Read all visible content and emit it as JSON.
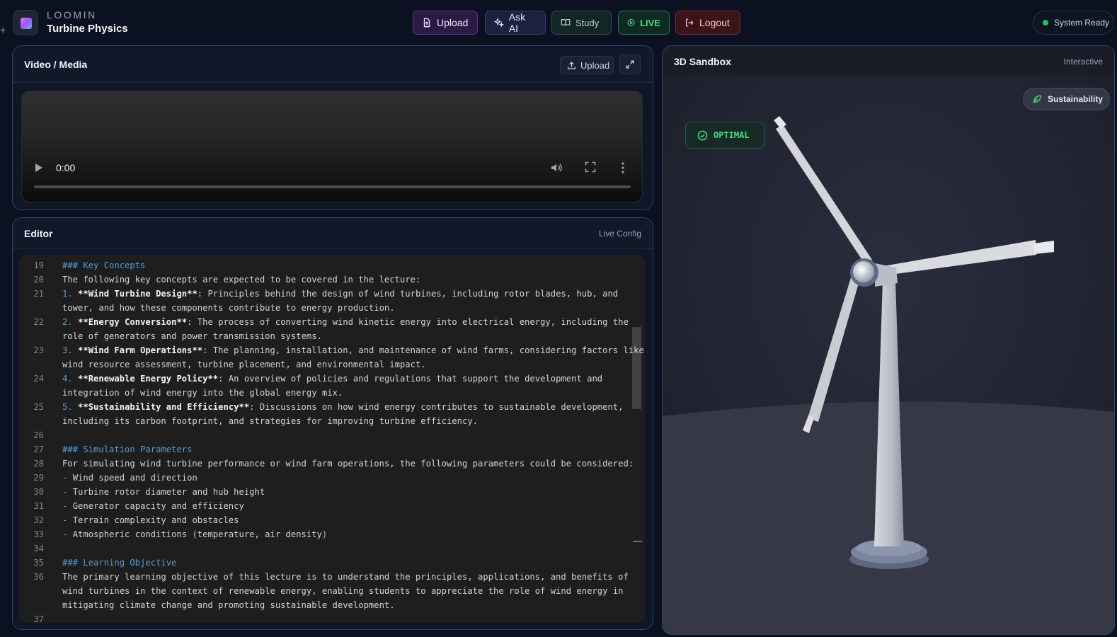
{
  "header": {
    "brand_name": "LOOMIN",
    "project_title": "Turbine Physics",
    "buttons": {
      "upload": "Upload",
      "ask_ai": "Ask AI",
      "study": "Study",
      "live": "LIVE",
      "logout": "Logout"
    },
    "status": "System Ready"
  },
  "video_panel": {
    "title": "Video / Media",
    "upload_label": "Upload",
    "current_time": "0:00"
  },
  "editor_panel": {
    "title": "Editor",
    "mode_label": "Live Config",
    "lines": [
      {
        "n": "19",
        "text": "### Key Concepts"
      },
      {
        "n": "20",
        "text": "The following key concepts are expected to be covered in the lecture:"
      },
      {
        "n": "21",
        "text": "1. **Wind Turbine Design**: Principles behind the design of wind turbines, including rotor blades, hub, and"
      },
      {
        "n": "",
        "text": "tower, and how these components contribute to energy production."
      },
      {
        "n": "22",
        "text": "2. **Energy Conversion**: The process of converting wind kinetic energy into electrical energy, including the"
      },
      {
        "n": "",
        "text": "role of generators and power transmission systems."
      },
      {
        "n": "23",
        "text": "3. **Wind Farm Operations**: The planning, installation, and maintenance of wind farms, considering factors like"
      },
      {
        "n": "",
        "text": "wind resource assessment, turbine placement, and environmental impact."
      },
      {
        "n": "24",
        "text": "4. **Renewable Energy Policy**: An overview of policies and regulations that support the development and"
      },
      {
        "n": "",
        "text": "integration of wind energy into the global energy mix."
      },
      {
        "n": "25",
        "text": "5. **Sustainability and Efficiency**: Discussions on how wind energy contributes to sustainable development,"
      },
      {
        "n": "",
        "text": "including its carbon footprint, and strategies for improving turbine efficiency."
      },
      {
        "n": "26",
        "text": ""
      },
      {
        "n": "27",
        "text": "### Simulation Parameters"
      },
      {
        "n": "28",
        "text": "For simulating wind turbine performance or wind farm operations, the following parameters could be considered:"
      },
      {
        "n": "29",
        "text": "- Wind speed and direction"
      },
      {
        "n": "30",
        "text": "- Turbine rotor diameter and hub height"
      },
      {
        "n": "31",
        "text": "- Generator capacity and efficiency"
      },
      {
        "n": "32",
        "text": "- Terrain complexity and obstacles"
      },
      {
        "n": "33",
        "text": "- Atmospheric conditions (temperature, air density)"
      },
      {
        "n": "34",
        "text": ""
      },
      {
        "n": "35",
        "text": "### Learning Objective"
      },
      {
        "n": "36",
        "text": "The primary learning objective of this lecture is to understand the principles, applications, and benefits of"
      },
      {
        "n": "",
        "text": "wind turbines in the context of renewable energy, enabling students to appreciate the role of wind energy in"
      },
      {
        "n": "",
        "text": "mitigating climate change and promoting sustainable development."
      },
      {
        "n": "37",
        "text": ""
      }
    ]
  },
  "sandbox_panel": {
    "title": "3D Sandbox",
    "mode_label": "Interactive",
    "sustainability_label": "Sustainability",
    "status_badge": "OPTIMAL"
  },
  "colors": {
    "background": "#0b1120",
    "panel_border": "#2b4666",
    "live_green": "#4ade80",
    "heading_blue": "#569cd6"
  },
  "icons": [
    "file-upload-icon",
    "sparkles-icon",
    "book-icon",
    "play-circle-icon",
    "logout-icon",
    "upload-icon",
    "expand-icon",
    "play-icon",
    "volume-icon",
    "fullscreen-icon",
    "more-vertical-icon",
    "leaf-icon",
    "check-circle-icon"
  ]
}
